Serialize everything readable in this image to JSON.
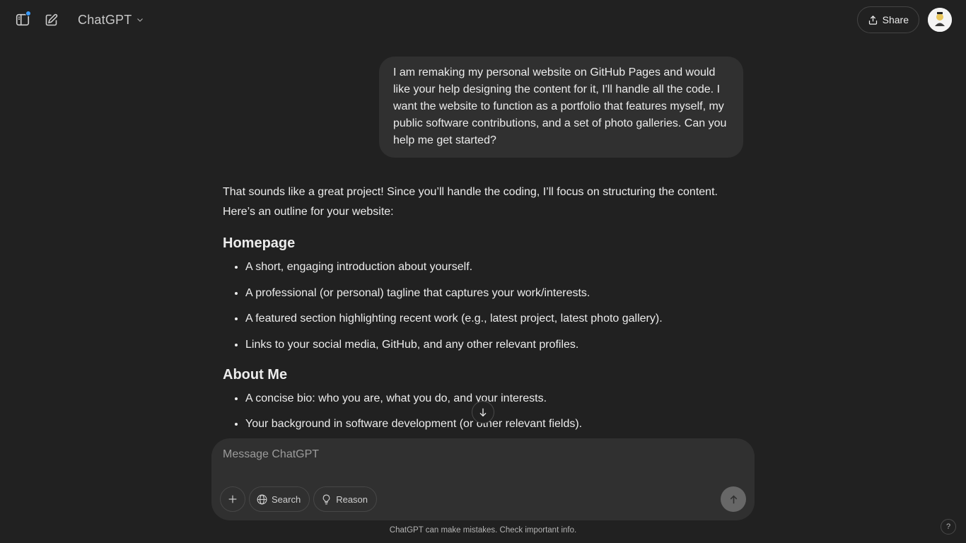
{
  "header": {
    "model_name": "ChatGPT",
    "share_label": "Share",
    "icons": {
      "sidebar": "sidebar-toggle-icon",
      "new_chat": "new-chat-icon",
      "model_dropdown": "chevron-down-icon",
      "share": "share-icon"
    },
    "notification_dot_color": "#3b9cff"
  },
  "conversation": {
    "user_message": "I am remaking my personal website on GitHub Pages and would like your help designing the content for it, I'll handle all the code. I want the website to function as a portfolio that features myself, my public software contributions, and a set of photo galleries. Can you help me get started?",
    "assistant": {
      "intro": "That sounds like a great project! Since you’ll handle the coding, I’ll focus on structuring the content. Here’s an outline for your website:",
      "sections": [
        {
          "heading": "Homepage",
          "items": [
            "A short, engaging introduction about yourself.",
            "A professional (or personal) tagline that captures your work/interests.",
            "A featured section highlighting recent work (e.g., latest project, latest photo gallery).",
            "Links to your social media, GitHub, and any other relevant profiles."
          ]
        },
        {
          "heading": "About Me",
          "items": [
            "A concise bio: who you are, what you do, and your interests.",
            "Your background in software development (or other relevant fields)."
          ]
        }
      ]
    }
  },
  "composer": {
    "placeholder": "Message ChatGPT",
    "search_label": "Search",
    "reason_label": "Reason",
    "icons": {
      "attach": "plus-icon",
      "search": "globe-icon",
      "reason": "lightbulb-icon",
      "send": "arrow-up-icon"
    }
  },
  "footer": {
    "disclaimer": "ChatGPT can make mistakes. Check important info.",
    "help_label": "?"
  },
  "colors": {
    "background": "#212121",
    "bubble": "#303030",
    "text": "#ececec",
    "muted_text": "#9b9b9b"
  }
}
